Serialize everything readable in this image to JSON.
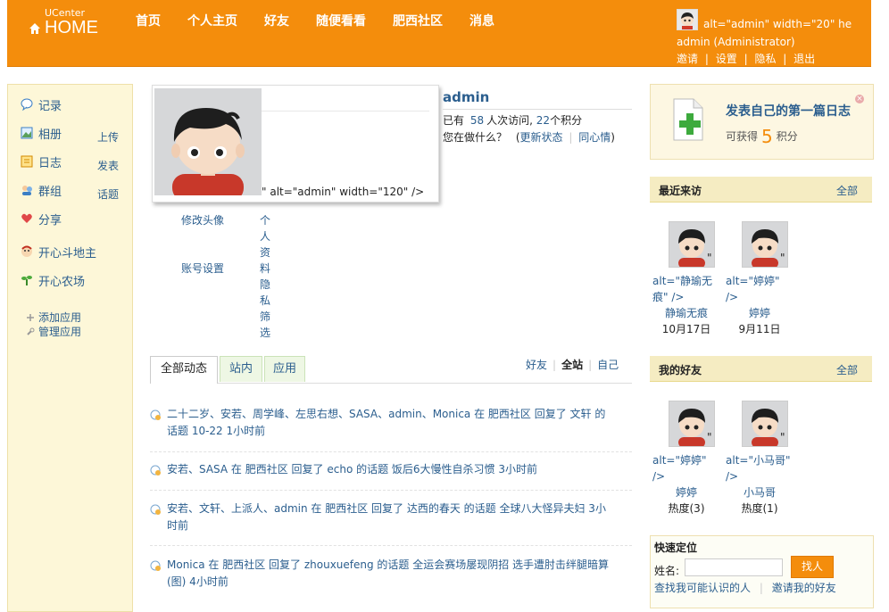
{
  "header": {
    "logo_small": "UCenter",
    "logo_big": "HOME",
    "nav": [
      "首页",
      "个人主页",
      "好友",
      "随便看看",
      "肥西社区",
      "消息"
    ],
    "user_alt": "alt=\"admin\" width=\"20\" he",
    "user_name": "admin (Administrator)",
    "user_links": [
      "邀请",
      "设置",
      "隐私",
      "退出"
    ],
    "link_sep": "|"
  },
  "sidebar": {
    "items": [
      {
        "label": "记录",
        "icon": "speech-bubble-icon",
        "sub": ""
      },
      {
        "label": "相册",
        "icon": "photo-album-icon",
        "sub": "上传"
      },
      {
        "label": "日志",
        "icon": "journal-icon",
        "sub": "发表"
      },
      {
        "label": "群组",
        "icon": "group-icon",
        "sub": "话题"
      },
      {
        "label": "分享",
        "icon": "share-heart-icon",
        "sub": ""
      },
      {
        "label": "开心斗地主",
        "icon": "cards-game-icon",
        "sub": ""
      },
      {
        "label": "开心农场",
        "icon": "farm-sprout-icon",
        "sub": ""
      }
    ],
    "add_app": "添加应用",
    "manage_app": "管理应用"
  },
  "profile": {
    "avatar_alt": "\" alt=\"admin\" width=\"120\" />",
    "name": "admin",
    "stat_prefix": "已有",
    "visits": "58",
    "stat_mid": "人次访问,",
    "points": "22",
    "stat_suffix": "个积分",
    "doing_label": "您在做什么？",
    "update_status": "更新状态",
    "same_mood": "同心情",
    "change_avatar": "修改头像",
    "account_settings": "账号设置",
    "vertical_links": [
      "个",
      "人",
      "资",
      "料",
      "隐",
      "私",
      "筛",
      "选"
    ]
  },
  "tabs": [
    "全部动态",
    "站内",
    "应用"
  ],
  "filters": [
    "好友",
    "全站",
    "自己"
  ],
  "feed": [
    {
      "text": "二十二岁、安若、周学峰、左思右想、SASA、admin、Monica 在 肥西社区 回复了 文轩 的话题 10-22 1小时前"
    },
    {
      "text": "安若、SASA 在 肥西社区 回复了 echo 的话题 饭后6大慢性自杀习惯 3小时前"
    },
    {
      "text": "安若、文轩、上派人、admin 在 肥西社区 回复了 达西的春天 的话题 全球八大怪异夫妇 3小时前"
    },
    {
      "text": "Monica 在 肥西社区 回复了 zhouxuefeng 的话题 全运会赛场屡现阴招 选手遭肘击绊腿暗算(图) 4小时前"
    }
  ],
  "blog_promo": {
    "title": "发表自己的第一篇日志",
    "prefix": "可获得",
    "points": "5",
    "suffix": "积分",
    "close": "×"
  },
  "recent": {
    "title": "最近来访",
    "all": "全部",
    "people": [
      {
        "alt": "alt=\"静瑜无痕\" />",
        "name": "静瑜无痕",
        "date": "10月17日",
        "quote": "\""
      },
      {
        "alt": "alt=\"婷婷\" />",
        "name": "婷婷",
        "date": "9月11日",
        "quote": "\""
      }
    ]
  },
  "friends": {
    "title": "我的好友",
    "all": "全部",
    "people": [
      {
        "alt": "alt=\"婷婷\" />",
        "name": "婷婷",
        "heat": "热度(3)",
        "quote": "\""
      },
      {
        "alt": "alt=\"小马哥\" />",
        "name": "小马哥",
        "heat": "热度(1)",
        "quote": "\""
      }
    ]
  },
  "quick": {
    "title": "快速定位",
    "name_label": "姓名:",
    "button": "找人",
    "link1": "查找我可能认识的人",
    "link2": "邀请我的好友"
  },
  "colors": {
    "brand_orange": "#f48d0c",
    "link": "#2b5e8e",
    "sidebar_bg": "#fdf7d8"
  }
}
